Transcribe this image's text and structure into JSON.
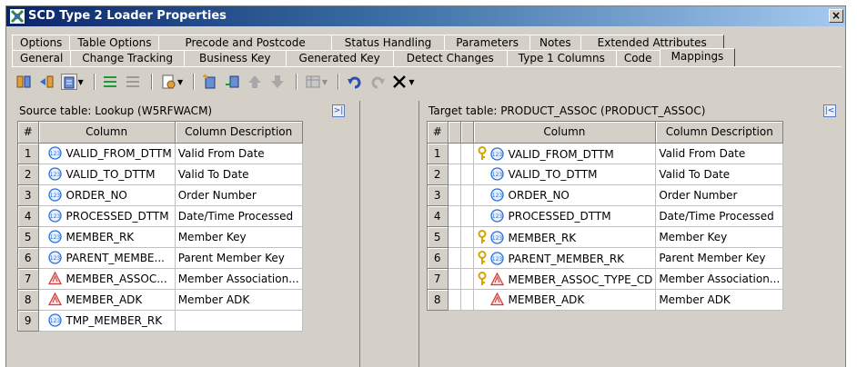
{
  "window": {
    "title": "SCD Type 2 Loader Properties",
    "close_label": "×"
  },
  "tabs": {
    "row1": [
      "Options",
      "Table Options",
      "Precode and Postcode",
      "Status Handling",
      "Parameters",
      "Notes",
      "Extended Attributes"
    ],
    "row2": [
      "General",
      "Change Tracking",
      "Business Key",
      "Generated Key",
      "Detect Changes",
      "Type 1 Columns",
      "Code",
      "Mappings"
    ],
    "active": "Mappings"
  },
  "toolbar": {
    "icons": [
      "map-left-icon",
      "map-right-icon",
      "map-options-icon",
      "map-all-icon",
      "unmap-all-icon",
      "quick-properties-icon",
      "new-column-icon",
      "import-column-icon",
      "move-up-icon",
      "move-down-icon",
      "table-view-icon",
      "undo-icon",
      "redo-icon",
      "delete-icon"
    ]
  },
  "source": {
    "label": "Source table: Lookup (W5RFWACM)",
    "headers": [
      "#",
      "Column",
      "Column Description"
    ],
    "rows": [
      {
        "num": "1",
        "type": "numeric",
        "column": "VALID_FROM_DTTM",
        "desc": "Valid From Date"
      },
      {
        "num": "2",
        "type": "numeric",
        "column": "VALID_TO_DTTM",
        "desc": "Valid To Date"
      },
      {
        "num": "3",
        "type": "numeric",
        "column": "ORDER_NO",
        "desc": "Order Number"
      },
      {
        "num": "4",
        "type": "numeric",
        "column": "PROCESSED_DTTM",
        "desc": "Date/Time Processed"
      },
      {
        "num": "5",
        "type": "numeric",
        "column": "MEMBER_RK",
        "desc": "Member Key"
      },
      {
        "num": "6",
        "type": "numeric",
        "column": "PARENT_MEMBE...",
        "desc": "Parent Member Key"
      },
      {
        "num": "7",
        "type": "character",
        "column": "MEMBER_ASSOC...",
        "desc": "Member Association..."
      },
      {
        "num": "8",
        "type": "character",
        "column": "MEMBER_ADK",
        "desc": "Member ADK"
      },
      {
        "num": "9",
        "type": "numeric",
        "column": "TMP_MEMBER_RK",
        "desc": ""
      }
    ]
  },
  "target": {
    "label": "Target table: PRODUCT_ASSOC (PRODUCT_ASSOC)",
    "headers": [
      "#",
      "",
      "",
      "Column",
      "Column Description"
    ],
    "rows": [
      {
        "num": "1",
        "key": true,
        "type": "numeric",
        "column": "VALID_FROM_DTTM",
        "desc": "Valid From Date"
      },
      {
        "num": "2",
        "key": false,
        "type": "numeric",
        "column": "VALID_TO_DTTM",
        "desc": "Valid To Date"
      },
      {
        "num": "3",
        "key": false,
        "type": "numeric",
        "column": "ORDER_NO",
        "desc": "Order Number"
      },
      {
        "num": "4",
        "key": false,
        "type": "numeric",
        "column": "PROCESSED_DTTM",
        "desc": "Date/Time Processed"
      },
      {
        "num": "5",
        "key": true,
        "type": "numeric",
        "column": "MEMBER_RK",
        "desc": "Member Key"
      },
      {
        "num": "6",
        "key": true,
        "type": "numeric",
        "column": "PARENT_MEMBER_RK",
        "desc": "Parent Member Key"
      },
      {
        "num": "7",
        "key": true,
        "type": "character",
        "column": "MEMBER_ASSOC_TYPE_CD",
        "desc": "Member Association..."
      },
      {
        "num": "8",
        "key": false,
        "type": "character",
        "column": "MEMBER_ADK",
        "desc": "Member ADK"
      }
    ]
  },
  "colors": {
    "title_start": "#0a246a",
    "title_end": "#a6caf0",
    "numeric_icon": "#2a6fd6",
    "character_icon": "#d23c3c",
    "key_icon": "#d6a400",
    "chrome": "#d4d0c8"
  }
}
